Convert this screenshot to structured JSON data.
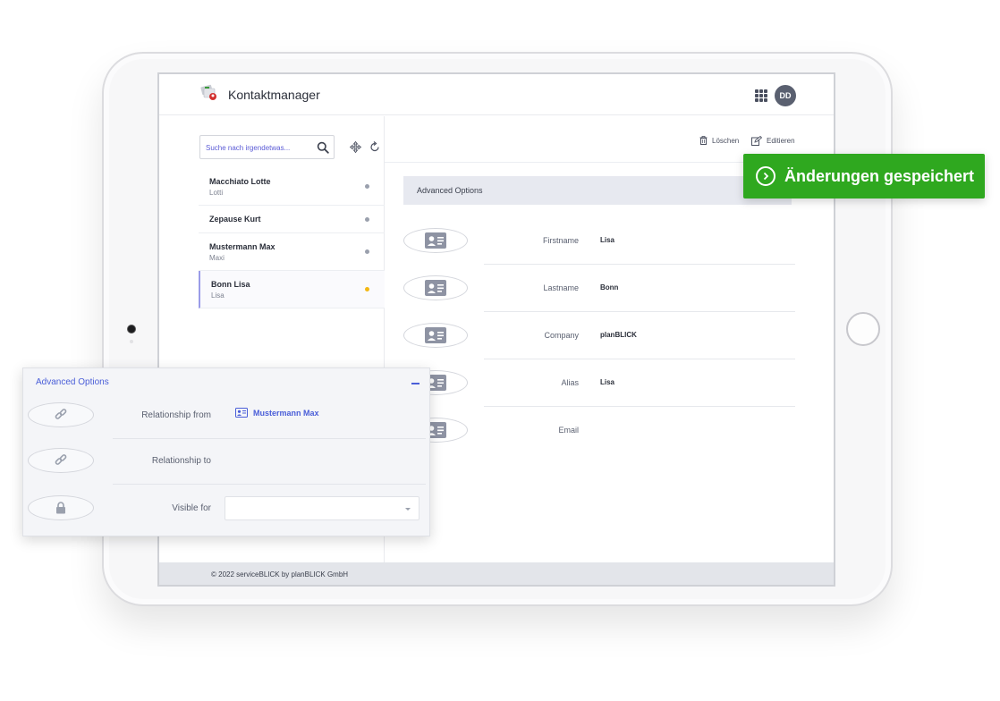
{
  "app": {
    "title": "Kontaktmanager",
    "user_initials": "DD"
  },
  "search": {
    "placeholder": "Suche nach irgendetwas..."
  },
  "contacts": [
    {
      "name": "Macchiato Lotte",
      "sub": "Lotti",
      "status_color": "#9aa0ad",
      "active": false
    },
    {
      "name": "Zepause Kurt",
      "sub": "",
      "status_color": "#9aa0ad",
      "active": false
    },
    {
      "name": "Mustermann Max",
      "sub": "Maxi",
      "status_color": "#9aa0ad",
      "active": false
    },
    {
      "name": "Bonn Lisa",
      "sub": "Lisa",
      "status_color": "#f3b814",
      "active": true
    }
  ],
  "toolbar": {
    "delete_label": "Löschen",
    "edit_label": "Editieren"
  },
  "details": {
    "section_title": "Advanced Options",
    "fields": [
      {
        "label": "Firstname",
        "value": "Lisa",
        "icon": "contact-card-icon"
      },
      {
        "label": "Lastname",
        "value": "Bonn",
        "icon": "contact-card-icon"
      },
      {
        "label": "Company",
        "value": "planBLICK",
        "icon": "contact-card-icon"
      },
      {
        "label": "Alias",
        "value": "Lisa",
        "icon": "contact-card-icon"
      },
      {
        "label": "Email",
        "value": "",
        "icon": "contact-card-icon"
      }
    ]
  },
  "footer": {
    "copyright": "© 2022 serviceBLICK by planBLICK GmbH"
  },
  "overlay": {
    "title": "Advanced Options",
    "rows": [
      {
        "label": "Relationship from",
        "icon": "link-icon",
        "value": "Mustermann Max"
      },
      {
        "label": "Relationship to",
        "icon": "link-icon",
        "value": ""
      },
      {
        "label": "Visible for",
        "icon": "lock-icon",
        "value": ""
      }
    ]
  },
  "toast": {
    "message": "Änderungen gespeichert",
    "color": "#2fa81f"
  },
  "colors": {
    "accent": "#4a5ed8",
    "active_dot": "#f3b814"
  }
}
